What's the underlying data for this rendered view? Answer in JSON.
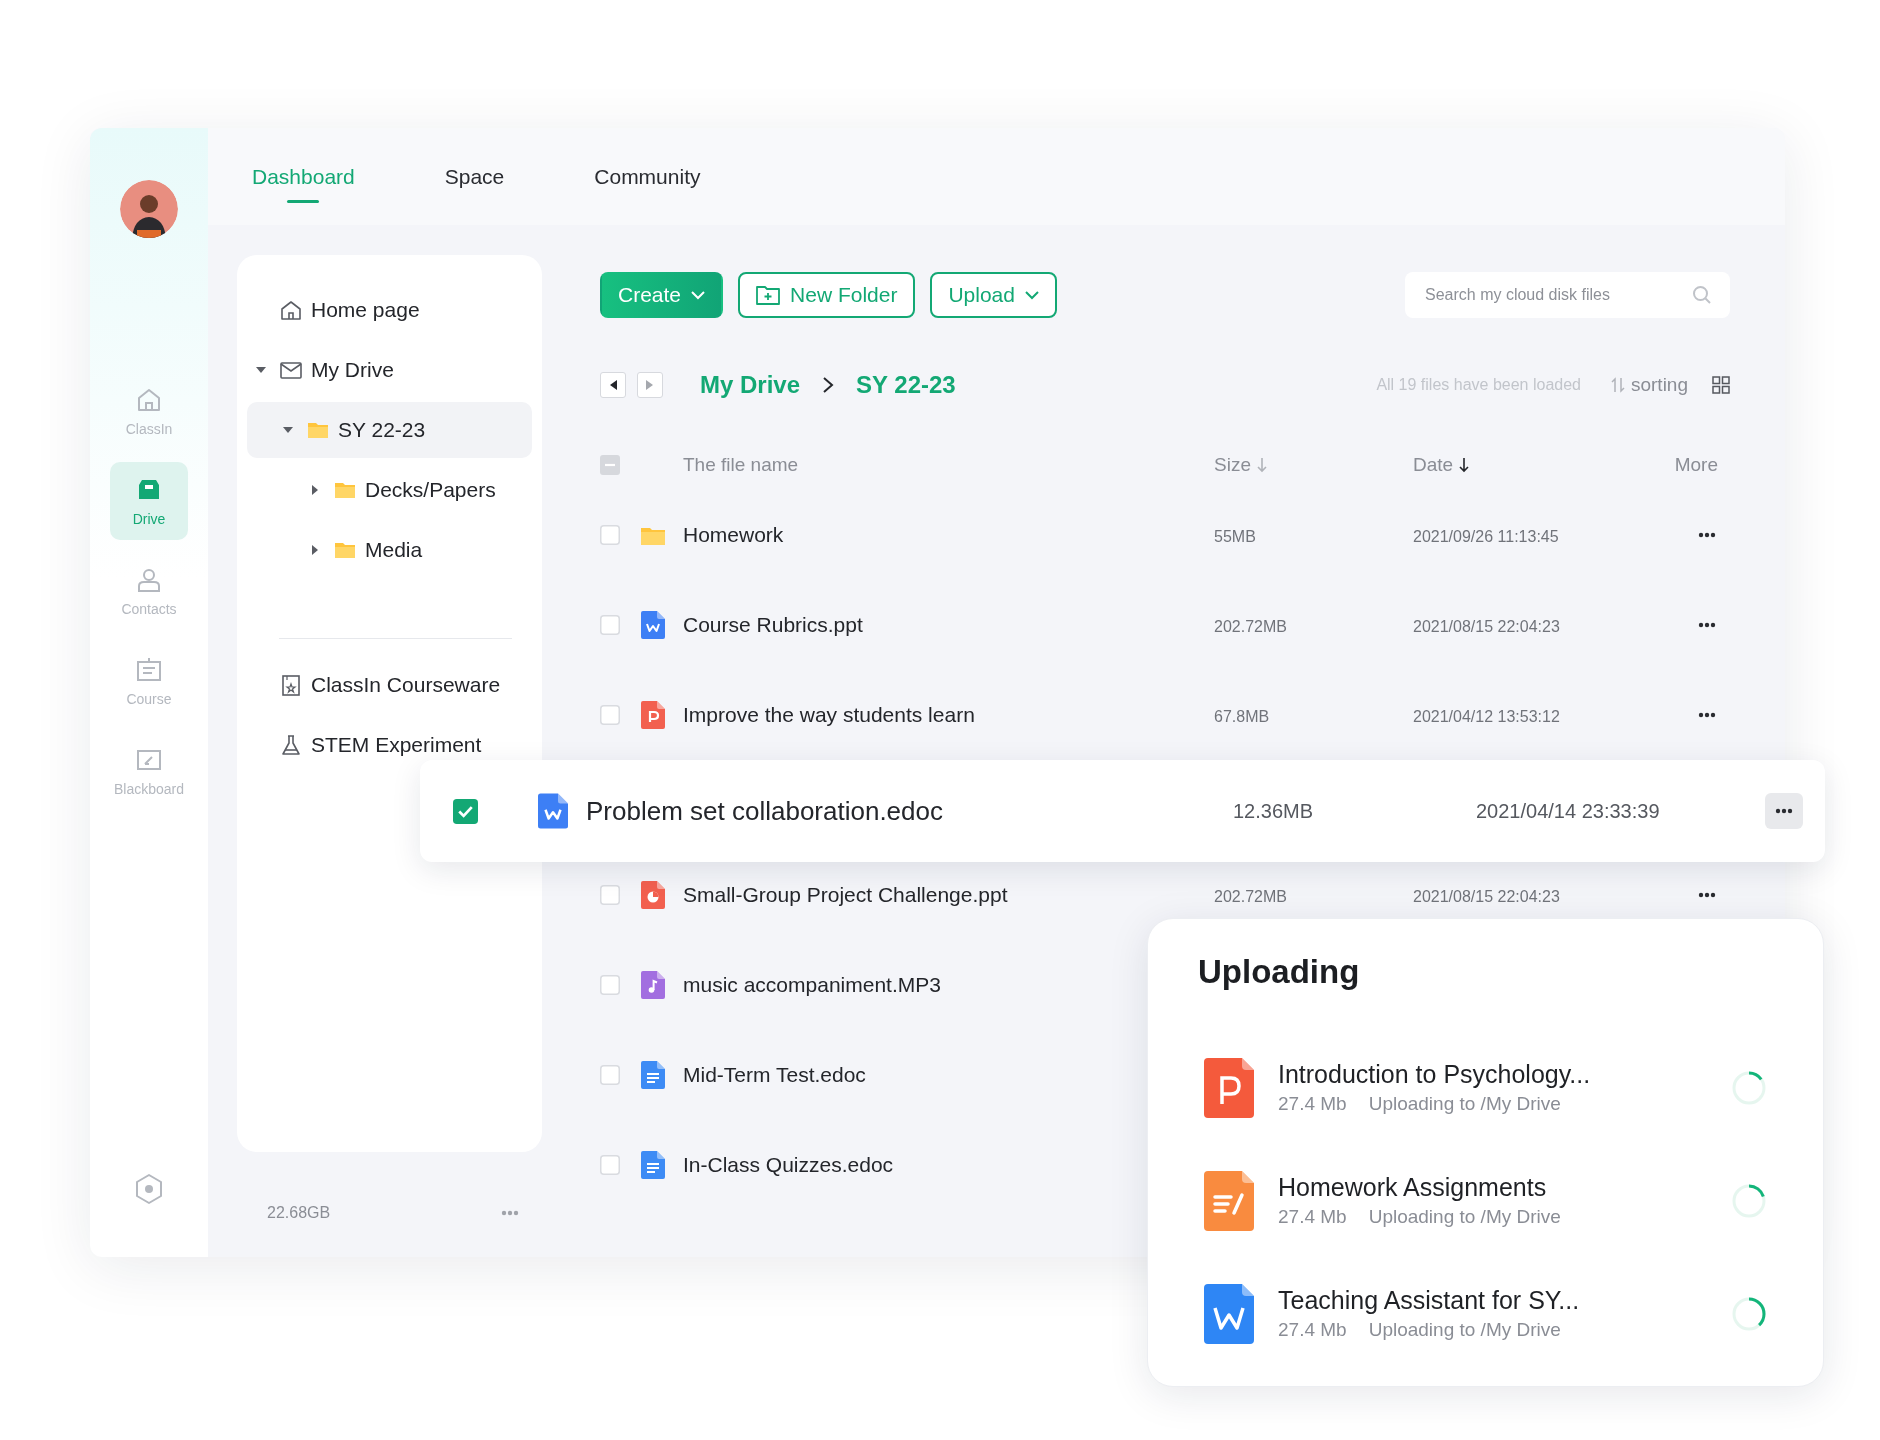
{
  "rail": {
    "items": [
      {
        "label": "ClassIn",
        "kind": "home",
        "selected": false
      },
      {
        "label": "Drive",
        "kind": "drive",
        "selected": true
      },
      {
        "label": "Contacts",
        "kind": "contacts",
        "selected": false
      },
      {
        "label": "Course",
        "kind": "course",
        "selected": false
      },
      {
        "label": "Blackboard",
        "kind": "blackboard",
        "selected": false
      }
    ]
  },
  "tabs": [
    {
      "label": "Dashboard",
      "selected": true
    },
    {
      "label": "Space",
      "selected": false
    },
    {
      "label": "Community",
      "selected": false
    }
  ],
  "tree": {
    "items": [
      {
        "label": "Home page",
        "kind": "home",
        "selected": false
      },
      {
        "label": "My Drive",
        "kind": "drive",
        "expanded": true,
        "selected": false,
        "children": [
          {
            "label": "SY 22-23",
            "kind": "folder",
            "expanded": true,
            "selected": true,
            "children": [
              {
                "label": "Decks/Papers",
                "kind": "folder",
                "expanded": false,
                "selected": false
              },
              {
                "label": "Media",
                "kind": "folder",
                "expanded": false,
                "selected": false
              }
            ]
          }
        ]
      }
    ],
    "extra_items": [
      {
        "label": "ClassIn Courseware",
        "kind": "courseware"
      },
      {
        "label": "STEM Experiment",
        "kind": "flask"
      }
    ],
    "storage": "22.68GB"
  },
  "toolbar": {
    "create": "Create",
    "new_folder": "New Folder",
    "upload": "Upload",
    "search": {
      "placeholder": "Search my cloud disk files"
    }
  },
  "navigation": {
    "back": {
      "disabled": false
    },
    "forward": {
      "disabled": true
    }
  },
  "breadcrumb": [
    "My Drive",
    "SY 22-23"
  ],
  "status": "All 19 files have been loaded",
  "sorting": "sorting",
  "table": {
    "select_all": {
      "indeterminate": true
    },
    "columns": [
      {
        "label": "The file name"
      },
      {
        "label": "Size",
        "sort_active": false
      },
      {
        "label": "Date",
        "sort_active": true
      },
      {
        "label": "More"
      }
    ],
    "rows": [
      {
        "name": "Homework",
        "kind": "folder",
        "size": "55MB",
        "date": "2021/09/26 11:13:45",
        "checked": false,
        "floating": false
      },
      {
        "name": "Course Rubrics.ppt",
        "kind": "word",
        "size": "202.72MB",
        "date": "2021/08/15 22:04:23",
        "checked": false,
        "floating": false
      },
      {
        "name": "Improve the way students learn",
        "kind": "slides",
        "size": "67.8MB",
        "date": "2021/04/12 13:53:12",
        "checked": false,
        "floating": false
      },
      {
        "name": "Problem set collaboration.edoc",
        "kind": "word",
        "size": "12.36MB",
        "date": "2021/04/14 23:33:39",
        "checked": true,
        "floating": true
      },
      {
        "name": "Small-Group Project Challenge.ppt",
        "kind": "chart",
        "size": "202.72MB",
        "date": "2021/08/15 22:04:23",
        "checked": false,
        "floating": false
      },
      {
        "name": "music accompaniment.MP3",
        "kind": "audio",
        "checked": false,
        "floating": false
      },
      {
        "name": "Mid-Term Test.edoc",
        "kind": "doc",
        "checked": false,
        "floating": false
      },
      {
        "name": "In-Class Quizzes.edoc",
        "kind": "doc",
        "checked": false,
        "floating": false
      }
    ]
  },
  "uploading": {
    "title": "Uploading",
    "items": [
      {
        "name": "Introduction to Psychology...",
        "kind": "slides",
        "size": "27.4 Mb",
        "destination": "Uploading to /My Drive",
        "level": 0.15
      },
      {
        "name": "Homework Assignments",
        "kind": "pages",
        "size": "27.4 Mb",
        "destination": "Uploading to /My Drive",
        "level": 0.2
      },
      {
        "name": "Teaching Assistant for SY...",
        "kind": "word",
        "size": "27.4 Mb",
        "destination": "Uploading to /My Drive",
        "level": 0.38
      }
    ]
  }
}
